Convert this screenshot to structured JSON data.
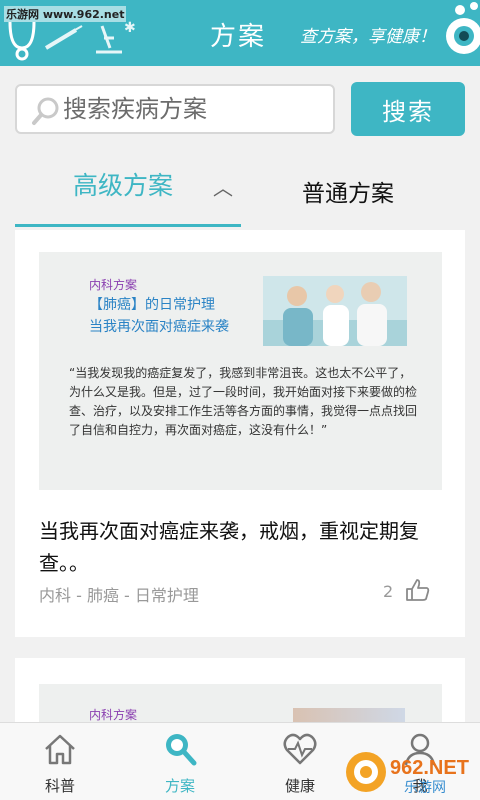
{
  "watermark_top": "乐游网 www.962.net",
  "header": {
    "title": "方案",
    "slogan": "查方案，享健康！"
  },
  "search": {
    "placeholder": "搜索疾病方案",
    "button_label": "搜索"
  },
  "tabs": [
    {
      "label": "高级方案",
      "active": true
    },
    {
      "label": "普通方案",
      "active": false
    }
  ],
  "articles": [
    {
      "thumb": {
        "category": "内科方案",
        "title_line1": "【肺癌】的日常护理",
        "title_line2": "当我再次面对癌症来袭",
        "quote": "“当我发现我的癌症复发了，我感到非常沮丧。这也太不公平了，为什么又是我。但是，过了一段时间，我开始面对接下来要做的检查、治疗，以及安排工作生活等各方面的事情，我觉得一点点找回了自信和自控力，再次面对癌症，这没有什么！”"
      },
      "title": "当我再次面对癌症来袭，戒烟，重视定期复查。。",
      "meta": "内科 - 肺癌 - 日常护理",
      "likes": "2"
    },
    {
      "thumb": {
        "category": "内科方案"
      }
    }
  ],
  "bottom_nav": [
    {
      "label": "科普",
      "icon": "home-icon"
    },
    {
      "label": "方案",
      "icon": "search-icon"
    },
    {
      "label": "健康",
      "icon": "heart-pulse-icon"
    },
    {
      "label": "我",
      "icon": "user-icon"
    }
  ],
  "watermark_bottom": {
    "logo": "962.NET",
    "sub": "乐游网"
  },
  "colors": {
    "accent": "#3eb6c4",
    "meta_gray": "#999999",
    "thumb_purple": "#8a3fb0",
    "thumb_blue": "#2a83c5"
  }
}
